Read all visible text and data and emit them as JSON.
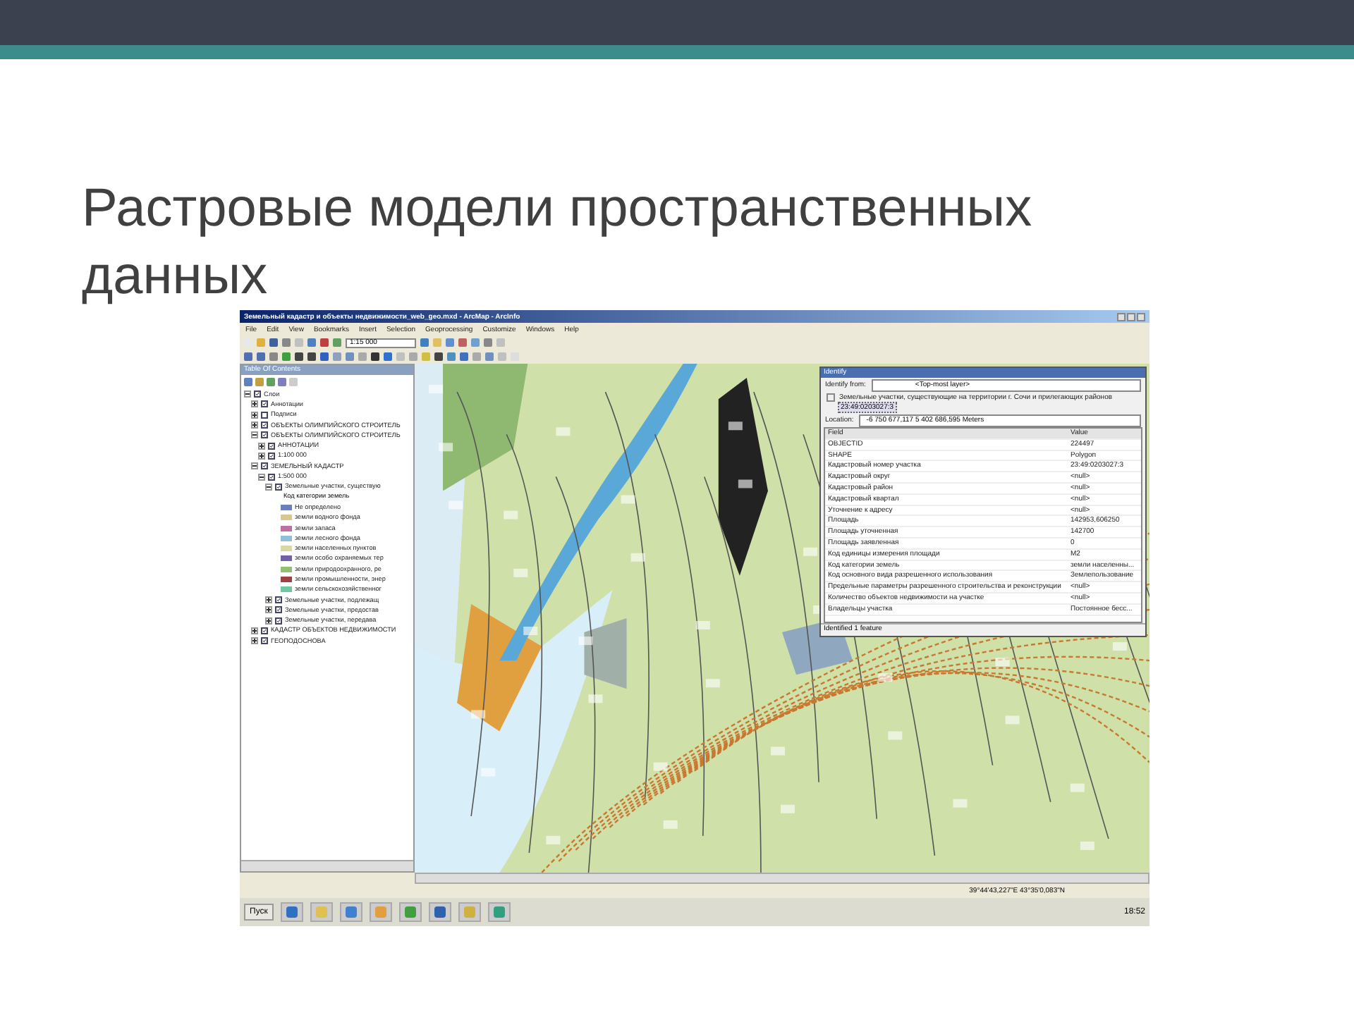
{
  "slide": {
    "title": "Растровые модели пространственных данных"
  },
  "app": {
    "window_title": "Земельный кадастр и объекты недвижимости_web_geo.mxd - ArcMap - ArcInfo",
    "menu": [
      "File",
      "Edit",
      "View",
      "Bookmarks",
      "Insert",
      "Selection",
      "Geoprocessing",
      "Customize",
      "Windows",
      "Help"
    ],
    "scale": "1:15 000",
    "toc": {
      "title": "Table Of Contents",
      "tree": [
        {
          "label": "Слои",
          "checked": true,
          "expanded": true,
          "children": [
            {
              "label": "Аннотации",
              "checked": true,
              "expanded": false
            },
            {
              "label": "Подписи",
              "checked": false,
              "expanded": false
            },
            {
              "label": "ОБЪЕКТЫ ОЛИМПИЙСКОГО СТРОИТЕЛЬ",
              "checked": true,
              "expanded": false
            },
            {
              "label": "ОБЪЕКТЫ ОЛИМПИЙСКОГО СТРОИТЕЛЬ",
              "checked": true,
              "expanded": true,
              "children": [
                {
                  "label": "АННОТАЦИИ",
                  "checked": true,
                  "expanded": false
                },
                {
                  "label": "1:100 000",
                  "checked": true,
                  "expanded": false
                }
              ]
            },
            {
              "label": "ЗЕМЕЛЬНЫЙ КАДАСТР",
              "checked": true,
              "expanded": true,
              "children": [
                {
                  "label": "1:500 000",
                  "checked": true,
                  "expanded": true,
                  "children": [
                    {
                      "label": "Земельные участки, существую",
                      "checked": true,
                      "expanded": true,
                      "legend_title": "Код категории земель",
                      "legend": [
                        {
                          "label": "Не определено",
                          "color": "#6a7fc0"
                        },
                        {
                          "label": "земли водного фонда",
                          "color": "#d8c890"
                        },
                        {
                          "label": "земли запаса",
                          "color": "#c070a0"
                        },
                        {
                          "label": "земли лесного фонда",
                          "color": "#90c0d8"
                        },
                        {
                          "label": "земли населенных пунктов",
                          "color": "#d8d8a0"
                        },
                        {
                          "label": "земли особо охраняемых тер",
                          "color": "#7060a8"
                        },
                        {
                          "label": "земли природоохранного, ре",
                          "color": "#90c070"
                        },
                        {
                          "label": "земли промышленности, энер",
                          "color": "#a04040"
                        },
                        {
                          "label": "земли сельскохозяйственног",
                          "color": "#70c8a0"
                        }
                      ]
                    },
                    {
                      "label": "Земельные участки, подлежащ",
                      "checked": true,
                      "expanded": false
                    },
                    {
                      "label": "Земельные участки, предостав",
                      "checked": true,
                      "expanded": false
                    },
                    {
                      "label": "Земельные участки, передава",
                      "checked": true,
                      "expanded": false
                    }
                  ]
                }
              ]
            },
            {
              "label": "КАДАСТР ОБЪЕКТОВ НЕДВИЖИМОСТИ",
              "checked": true,
              "expanded": false
            },
            {
              "label": "ГЕОПОДОСНОВА",
              "checked": true,
              "expanded": false
            }
          ]
        }
      ]
    },
    "identify": {
      "title": "Identify",
      "from_label": "Identify from:",
      "from": "<Top-most layer>",
      "layer": "Земельные участки, существующие на территории г. Сочи и прилегающих районов",
      "feature": "23:49:0203027:3",
      "location_label": "Location:",
      "location": "-6 750 677,117  5 402 686,595 Meters",
      "columns": [
        "Field",
        "Value"
      ],
      "rows": [
        [
          "OBJECTID",
          "224497"
        ],
        [
          "SHAPE",
          "Polygon"
        ],
        [
          "Кадастровый номер участка",
          "23:49:0203027:3"
        ],
        [
          "Кадастровый округ",
          "<null>"
        ],
        [
          "Кадастровый район",
          "<null>"
        ],
        [
          "Кадастровый квартал",
          "<null>"
        ],
        [
          "Уточнение к адресу",
          "<null>"
        ],
        [
          "Площадь",
          "142953,606250"
        ],
        [
          "Площадь уточненная",
          "142700"
        ],
        [
          "Площадь заявленная",
          "0"
        ],
        [
          "Код единицы измерения площади",
          "М2"
        ],
        [
          "Код категории земель",
          "земли населенны..."
        ],
        [
          "Код основного вида разрешенного использования",
          "Землепользование"
        ],
        [
          "Предельные параметры разрешенного строительства и реконструкции",
          "<null>"
        ],
        [
          "Количество объектов недвижимости на участке",
          "<null>"
        ],
        [
          "Владельцы участка",
          "Постоянное бесс..."
        ]
      ],
      "status": "Identified 1 feature"
    },
    "coordinates": "39°44'43,227\"E  43°35'0,083\"N",
    "taskbar": {
      "start": "Пуск",
      "clock": "18:52"
    }
  }
}
